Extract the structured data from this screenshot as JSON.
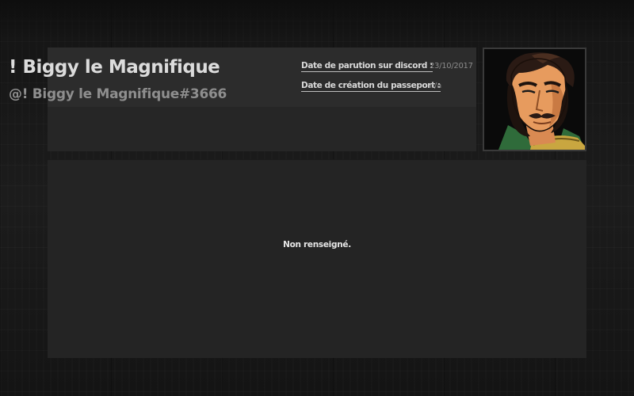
{
  "profile": {
    "display_name": "! Biggy le Magnifique",
    "discord_tag": "@! Biggy le Magnifique#3666",
    "avatar_icon": "character-portrait-icon"
  },
  "details": [
    {
      "label": "Date de parution sur discord :",
      "value": "23/10/2017"
    },
    {
      "label": "Date de création du passeport :",
      "value": "n/a"
    }
  ],
  "bio": {
    "text": "Non renseigné."
  },
  "colors": {
    "background": "#161616",
    "panel": "#262626",
    "panel_header": "#2c2c2c",
    "bio_panel": "#242424",
    "name_text": "#dcdcdc",
    "tag_text": "#8e8e8e",
    "label_text": "#d8d8d8",
    "value_text": "#8a8a8a"
  }
}
